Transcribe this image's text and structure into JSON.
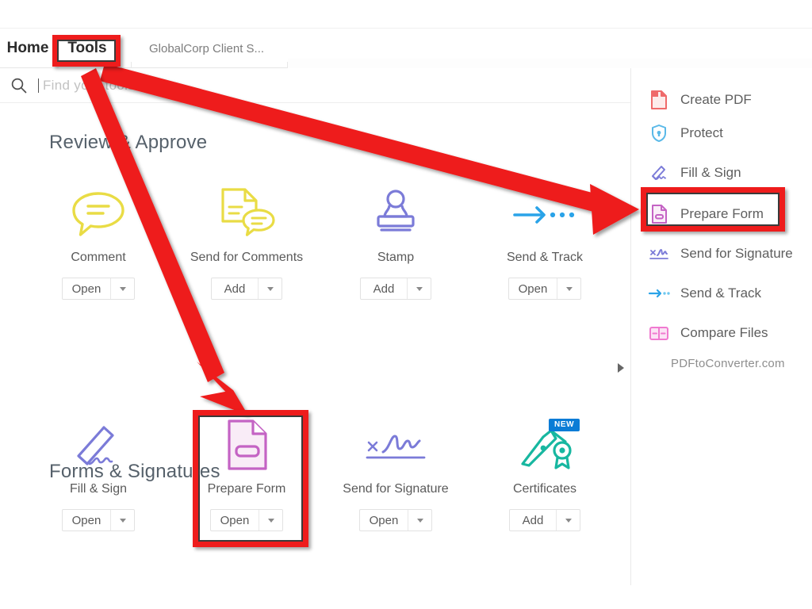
{
  "window": {
    "tabs": [
      {
        "label": "Home",
        "name": "tab-home"
      },
      {
        "label": "Tools",
        "name": "tab-tools"
      },
      {
        "label": "GlobalCorp Client S...",
        "name": "tab-document"
      }
    ]
  },
  "search": {
    "placeholder": "Find your tools here",
    "value": "",
    "icon": "search-icon"
  },
  "main": {
    "sections": [
      {
        "title": "Review & Approve",
        "tiles": [
          {
            "label": "Comment",
            "action": "Open",
            "icon": "comment-bubble-icon",
            "color": "#eadb3f",
            "badge": ""
          },
          {
            "label": "Send for Comments",
            "action": "Add",
            "icon": "document-comment-icon",
            "color": "#eadb3f",
            "badge": ""
          },
          {
            "label": "Stamp",
            "action": "Add",
            "icon": "stamp-icon",
            "color": "#7b7bd8",
            "badge": ""
          },
          {
            "label": "Send & Track",
            "action": "Open",
            "icon": "arrow-track-icon",
            "color": "#2aa3e8",
            "badge": ""
          }
        ]
      },
      {
        "title": "Forms & Signatures",
        "tiles": [
          {
            "label": "Fill & Sign",
            "action": "Open",
            "icon": "pen-sign-icon",
            "color": "#7b7bd8",
            "badge": ""
          },
          {
            "label": "Prepare Form",
            "action": "Open",
            "icon": "prepare-form-icon",
            "color": "#c463c4",
            "badge": ""
          },
          {
            "label": "Send for Signature",
            "action": "Open",
            "icon": "signature-line-icon",
            "color": "#7b7bd8",
            "badge": ""
          },
          {
            "label": "Certificates",
            "action": "Add",
            "icon": "certificate-pen-icon",
            "color": "#17b7a0",
            "badge": "NEW"
          }
        ]
      }
    ]
  },
  "sidebar": {
    "items": [
      {
        "label": "Create PDF",
        "icon": "create-pdf-icon",
        "color": "#ef6a6a"
      },
      {
        "label": "Protect",
        "icon": "shield-icon",
        "color": "#5ab9e8"
      },
      {
        "label": "Fill & Sign",
        "icon": "pen-sign-icon",
        "color": "#7b7bd8"
      },
      {
        "label": "Prepare Form",
        "icon": "prepare-form-icon",
        "color": "#c463c4"
      },
      {
        "label": "Send for Signature",
        "icon": "signature-line-icon",
        "color": "#7b7bd8"
      },
      {
        "label": "Send & Track",
        "icon": "arrow-track-icon",
        "color": "#2aa3e8"
      },
      {
        "label": "Compare Files",
        "icon": "compare-files-icon",
        "color": "#f07ad0"
      }
    ]
  },
  "watermark": {
    "text": "PDFtoConverter.com"
  },
  "annotations": {
    "color": "#ee1c1c"
  }
}
